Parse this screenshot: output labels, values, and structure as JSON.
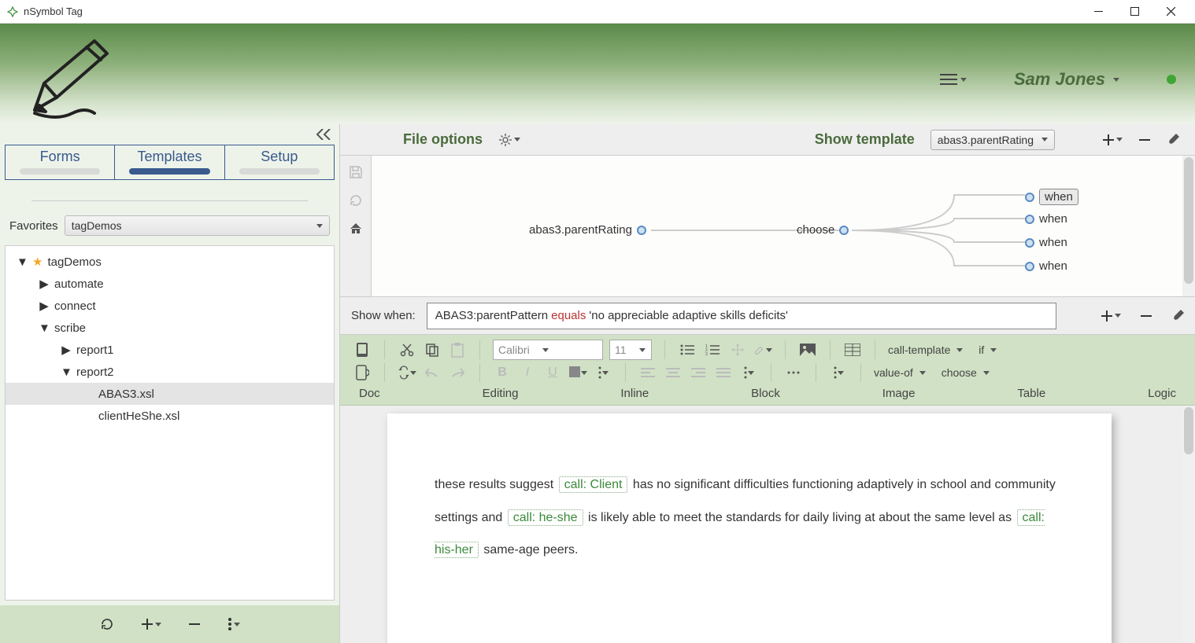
{
  "window": {
    "title": "nSymbol Tag"
  },
  "header": {
    "user": "Sam Jones"
  },
  "sidebar": {
    "tabs": [
      "Forms",
      "Templates",
      "Setup"
    ],
    "active_tab": 1,
    "favorites_label": "Favorites",
    "favorites_value": "tagDemos",
    "tree": [
      {
        "depth": 0,
        "label": "tagDemos",
        "arrow": "▼",
        "star": true
      },
      {
        "depth": 1,
        "label": "automate",
        "arrow": "▶"
      },
      {
        "depth": 1,
        "label": "connect",
        "arrow": "▶"
      },
      {
        "depth": 1,
        "label": "scribe",
        "arrow": "▼"
      },
      {
        "depth": 2,
        "label": "report1",
        "arrow": "▶"
      },
      {
        "depth": 2,
        "label": "report2",
        "arrow": "▼"
      },
      {
        "depth": 3,
        "label": "ABAS3.xsl",
        "arrow": "",
        "selected": true
      },
      {
        "depth": 3,
        "label": "clientHeShe.xsl",
        "arrow": ""
      }
    ]
  },
  "topstrip": {
    "file_options": "File options",
    "show_template": "Show template",
    "template_value": "abas3.parentRating"
  },
  "graph": {
    "root": "abas3.parentRating",
    "mid": "choose",
    "leaves": [
      "when",
      "when",
      "when",
      "when"
    ],
    "selected": 0
  },
  "condition": {
    "label": "Show when:",
    "lhs": "ABAS3:parentPattern",
    "op": "equals",
    "rhs": "'no appreciable adaptive skills deficits'"
  },
  "toolbar": {
    "font": "Calibri",
    "size": "11",
    "logic": {
      "call_template": "call-template",
      "if": "if",
      "value_of": "value-of",
      "choose": "choose"
    },
    "labels": {
      "doc": "Doc",
      "editing": "Editing",
      "inline": "Inline",
      "block": "Block",
      "image": "Image",
      "table": "Table",
      "logic": "Logic"
    }
  },
  "document": {
    "t1": "these results suggest",
    "tag1": "call: Client",
    "t2": "has no significant difficulties functioning adaptively in school and community settings and",
    "tag2": "call: he-she",
    "t3": "is likely able to meet the standards for daily living at about the same level as",
    "tag3": "call: his-her",
    "t4": "same-age peers."
  }
}
